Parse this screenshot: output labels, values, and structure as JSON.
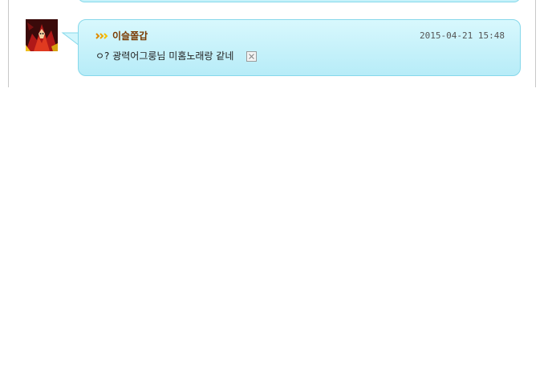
{
  "comment": {
    "username": "이슬쫄갑",
    "timestamp": "2015-04-21  15:48",
    "message": "ㅇ? 광력어그룽님 미홈노래랑 같네",
    "avatar_icon": "red-demon-avatar",
    "badge_icon": "rank-chevron-icon",
    "delete_icon": "close-x-icon"
  },
  "colors": {
    "bubble_bg": "#c6f2fa",
    "bubble_border": "#86d8ea",
    "username": "#7a3a00"
  }
}
